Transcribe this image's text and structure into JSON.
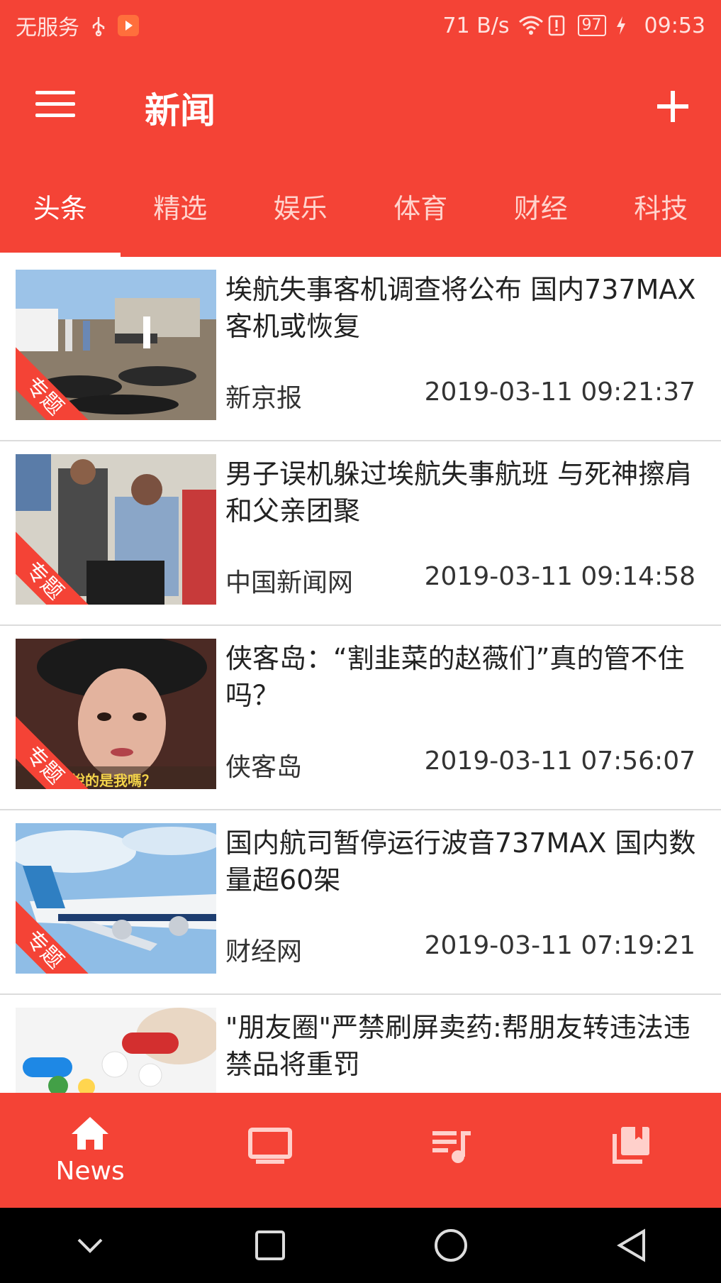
{
  "status_bar": {
    "carrier": "无服务",
    "speed": "71 B/s",
    "battery": "97",
    "time": "09:53"
  },
  "app_bar": {
    "title": "新闻",
    "menu_icon": "menu-icon",
    "add_icon": "add-icon"
  },
  "tabs": [
    {
      "label": "头条",
      "active": true
    },
    {
      "label": "精选",
      "active": false
    },
    {
      "label": "娱乐",
      "active": false
    },
    {
      "label": "体育",
      "active": false
    },
    {
      "label": "财经",
      "active": false
    },
    {
      "label": "科技",
      "active": false
    }
  ],
  "news": [
    {
      "headline": "埃航失事客机调查将公布 国内737MAX客机或恢复",
      "source": "新京报",
      "time": "2019-03-11 09:21:37",
      "tag": "专题"
    },
    {
      "headline": "男子误机躲过埃航失事航班 与死神擦肩和父亲团聚",
      "source": "中国新闻网",
      "time": "2019-03-11 09:14:58",
      "tag": "专题"
    },
    {
      "headline": "侠客岛：“割韭菜的赵薇们”真的管不住吗？",
      "source": "侠客岛",
      "time": "2019-03-11 07:56:07",
      "tag": "专题",
      "thumb_caption": "你說的是我嗎？"
    },
    {
      "headline": "国内航司暂停运行波音737MAX 国内数量超60架",
      "source": "财经网",
      "time": "2019-03-11 07:19:21",
      "tag": "专题"
    },
    {
      "headline": "\"朋友圈\"严禁刷屏卖药:帮朋友转违法违禁品将重罚",
      "source": "",
      "time": "",
      "tag": ""
    }
  ],
  "bottom_nav": [
    {
      "label": "News",
      "icon": "home-icon",
      "active": true
    },
    {
      "label": "",
      "icon": "tv-icon",
      "active": false
    },
    {
      "label": "",
      "icon": "playlist-music-icon",
      "active": false
    },
    {
      "label": "",
      "icon": "library-books-icon",
      "active": false
    }
  ],
  "colors": {
    "primary": "#f44336",
    "text": "#222222"
  }
}
